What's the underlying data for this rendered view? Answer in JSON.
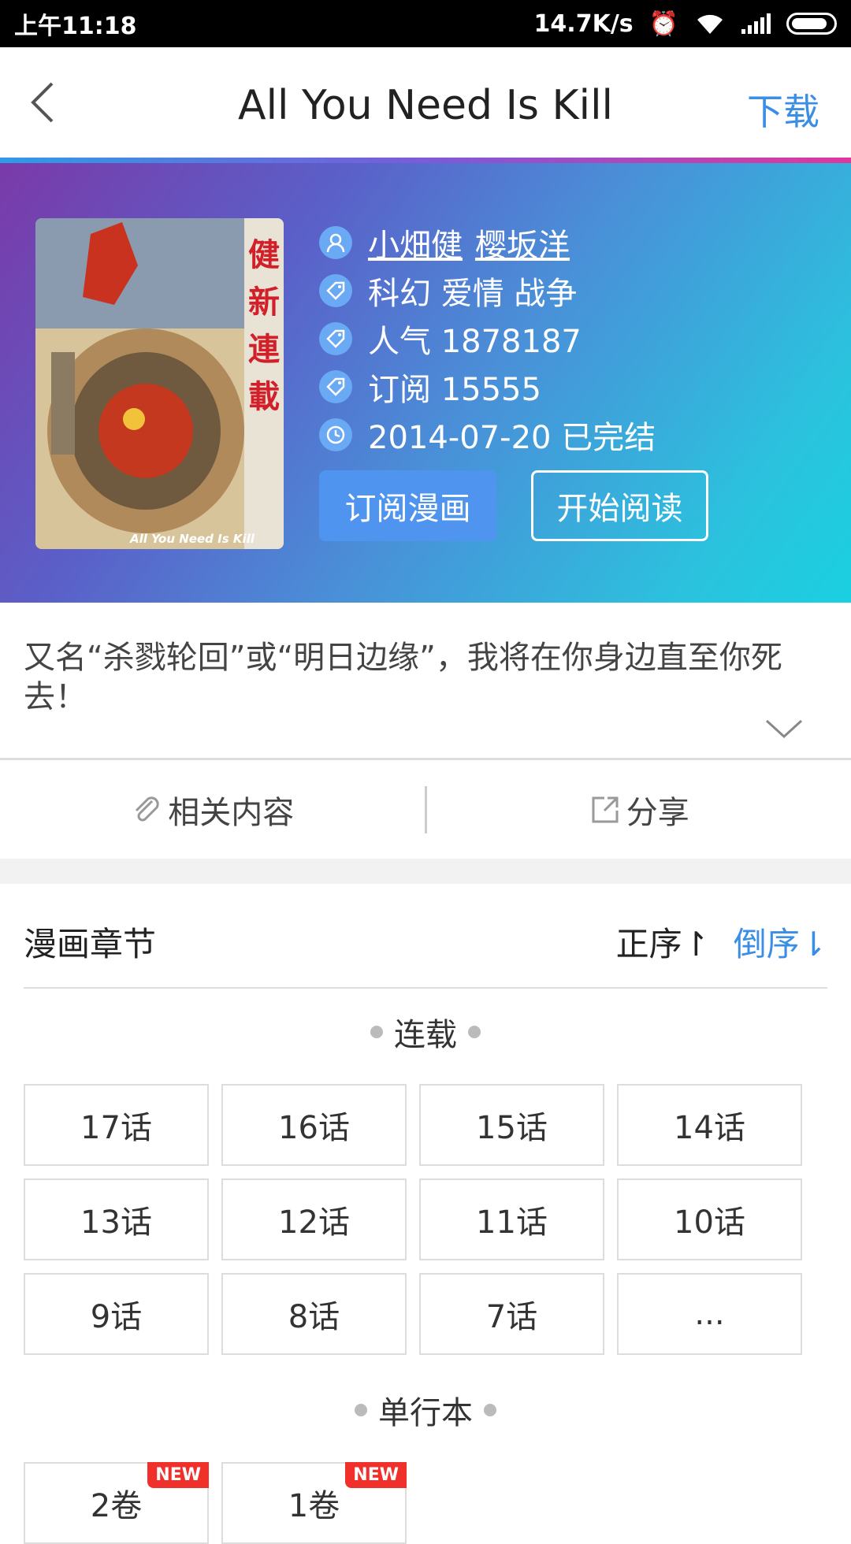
{
  "status": {
    "time": "上午11:18",
    "speed": "14.7K/s"
  },
  "header": {
    "title": "All You Need Is Kill",
    "download": "下载"
  },
  "cover": {
    "caption": "All You Need Is Kill"
  },
  "info": {
    "authors": [
      "小畑健",
      "樱坂洋"
    ],
    "genres": "科幻 爱情 战争",
    "popularity": "人气 1878187",
    "subscribes": "订阅 15555",
    "date_status": "2014-07-20 已完结"
  },
  "buttons": {
    "subscribe": "订阅漫画",
    "read": "开始阅读"
  },
  "description": "又名“杀戮轮回”或“明日边缘”，我将在你身边直至你死去！",
  "actions": {
    "related": "相关内容",
    "share": "分享"
  },
  "chapters": {
    "title": "漫画章节",
    "sort_asc": "正序↾",
    "sort_desc": "倒序⇂",
    "serial_label": "连载",
    "serial": [
      "17话",
      "16话",
      "15话",
      "14话",
      "13话",
      "12话",
      "11话",
      "10话",
      "9话",
      "8话",
      "7话",
      "..."
    ],
    "volume_label": "单行本",
    "volumes": [
      {
        "label": "2卷",
        "badge": "NEW"
      },
      {
        "label": "1卷",
        "badge": "NEW"
      }
    ]
  },
  "colors": {
    "accent": "#3a8ee6",
    "badge": "#f0302a"
  }
}
